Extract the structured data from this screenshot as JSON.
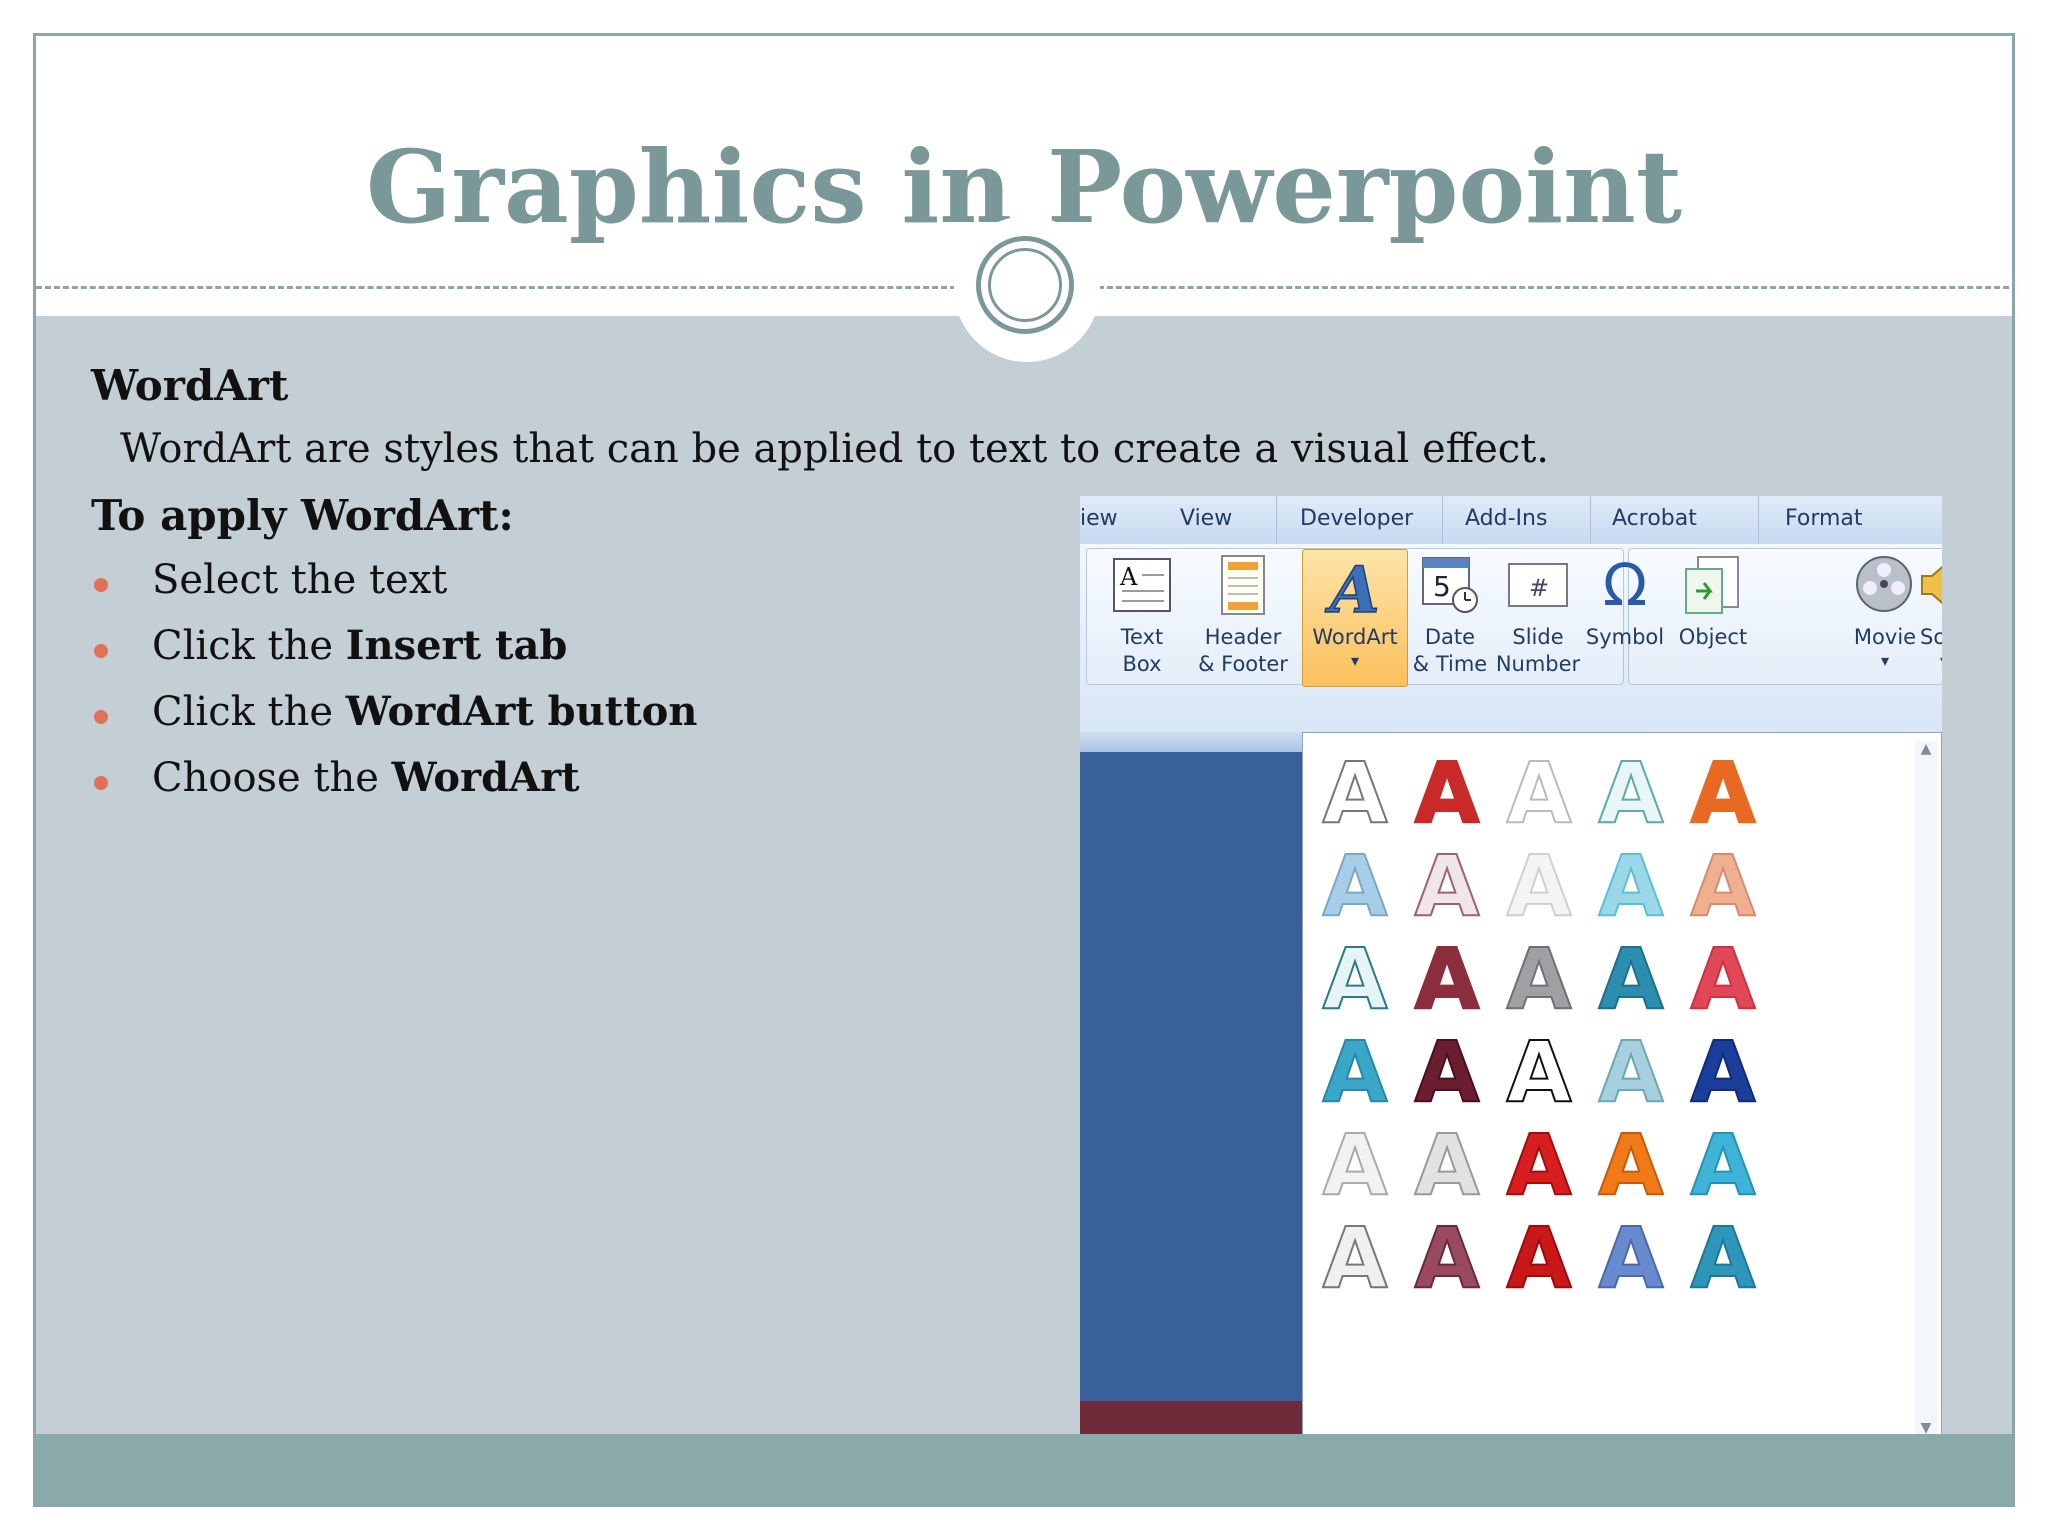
{
  "slide": {
    "title": "Graphics in Powerpoint",
    "heading": "WordArt",
    "description": "WordArt are styles that can be applied to text to create a visual effect.",
    "apply_heading": "To apply WordArt:",
    "bullets": [
      {
        "pre": "Select the text",
        "bold": ""
      },
      {
        "pre": "Click the ",
        "bold": "Insert tab"
      },
      {
        "pre": "Click the ",
        "bold": "WordArt button"
      },
      {
        "pre": "Choose the ",
        "bold": "WordArt"
      }
    ]
  },
  "ribbon": {
    "tabs": [
      "iew",
      "View",
      "Developer",
      "Add-Ins",
      "Acrobat",
      "Format"
    ],
    "buttons": {
      "text_box": [
        "Text",
        "Box"
      ],
      "header_footer": [
        "Header",
        "& Footer"
      ],
      "wordart": "WordArt",
      "date_time": [
        "Date",
        "& Time"
      ],
      "slide_number": [
        "Slide",
        "Number"
      ],
      "symbol": "Symbol",
      "object": "Object",
      "movie": "Movie",
      "sound": "Sou"
    },
    "icon_glyphs": {
      "text_box": "A",
      "wordart": "A",
      "date": "5",
      "slide_number": "#",
      "symbol": "Ω"
    },
    "arrow": "▾"
  },
  "gallery": {
    "glyph": "A",
    "up_arrow": "▲",
    "down_arrow": "▼",
    "styles": [
      [
        "#ffffff",
        "#c82a2a",
        "#ffffff",
        "#e8f6f6",
        "#e86a22"
      ],
      [
        "#a8cde8",
        "#f0e6e8",
        "#f4f4f4",
        "#9ad8e8",
        "#f0b090"
      ],
      [
        "#e6f4f6",
        "#8a2e3e",
        "#a0a0a4",
        "#2c8eae",
        "#e04858"
      ],
      [
        "#3aa6c8",
        "#6a1e30",
        "#ffffff",
        "#a8d0dc",
        "#1a3e9a"
      ],
      [
        "#f2f2f2",
        "#e2e2e2",
        "#d81e1e",
        "#f07a18",
        "#40b4d6"
      ],
      [
        "#f0f0f0",
        "#9a4a5e",
        "#c81818",
        "#6a8ad0",
        "#2e96b8"
      ]
    ],
    "strokes": [
      [
        "#777777",
        "#c82a2a",
        "#bbbbbb",
        "#5aaab0",
        "#e86a22"
      ],
      [
        "#7aa8c8",
        "#a06070",
        "#d0d0d0",
        "#5ac0d8",
        "#d88a70"
      ],
      [
        "#2a7a88",
        "#8a2e3e",
        "#707074",
        "#1e6e8e",
        "#d03040"
      ],
      [
        "#2a86a8",
        "#4a0e20",
        "#111111",
        "#6aa8b8",
        "#0e2e7a"
      ],
      [
        "#aaaaaa",
        "#999999",
        "#a00e0e",
        "#c85a08",
        "#2094b6"
      ],
      [
        "#777777",
        "#6a2a3e",
        "#a00a0a",
        "#4a6ab0",
        "#1e7698"
      ]
    ]
  }
}
